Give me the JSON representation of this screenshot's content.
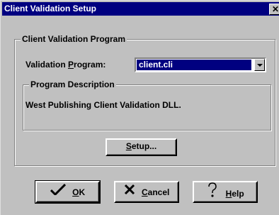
{
  "window": {
    "title": "Client Validation Setup",
    "close_glyph": "✕"
  },
  "group": {
    "title": "Client Validation Program"
  },
  "field": {
    "label_pre": "Validation ",
    "label_accel": "P",
    "label_post": "rogram:",
    "value": "client.cli"
  },
  "description": {
    "title": "Program Description",
    "text": "West Publishing Client Validation DLL."
  },
  "buttons": {
    "setup": {
      "accel": "S",
      "rest": "etup..."
    },
    "ok": {
      "accel": "O",
      "rest": "K",
      "icon": "checkmark-icon"
    },
    "cancel": {
      "accel": "C",
      "rest": "ancel",
      "icon": "x-icon"
    },
    "help": {
      "accel": "H",
      "rest": "elp",
      "icon": "question-mark-icon"
    }
  },
  "colors": {
    "face": "#c0c0c0",
    "titlebar": "#000080",
    "check": "#008000"
  }
}
